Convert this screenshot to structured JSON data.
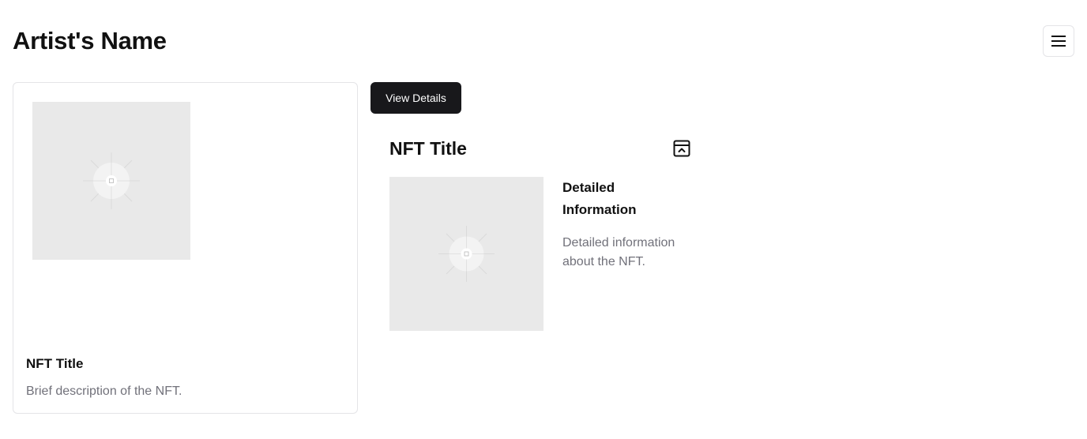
{
  "header": {
    "title": "Artist's Name",
    "menu_icon": "hamburger-menu-icon"
  },
  "nft_card": {
    "image_icon": "image-placeholder-icon",
    "title": "NFT Title",
    "description": "Brief description of the NFT."
  },
  "toolbar": {
    "view_details_label": "View Details"
  },
  "details_panel": {
    "title": "NFT Title",
    "collapse_icon": "collapse-panel-icon",
    "image_icon": "image-placeholder-icon",
    "heading": "Detailed Information",
    "text": "Detailed information about the NFT."
  },
  "colors": {
    "primary_button": "#18181b",
    "muted_text": "#71717a",
    "border": "#e4e4e7",
    "placeholder_bg": "#e9e9e9"
  }
}
